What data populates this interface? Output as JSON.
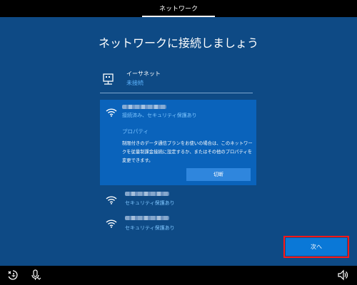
{
  "header": {
    "tab_label": "ネットワーク"
  },
  "main": {
    "title": "ネットワークに接続しましょう"
  },
  "ethernet": {
    "name": "イーサネット",
    "status": "未接続",
    "icon": "ethernet-icon"
  },
  "networks": [
    {
      "status": "接続済み、セキュリティ保護あり",
      "expanded": true,
      "properties_label": "プロパティ",
      "description": "制限付きのデータ通信プランをお使いの場合は、このネットワークを従量制課金接続に設定するか、またはその他のプロパティを変更できます。",
      "disconnect_label": "切断"
    },
    {
      "status": "セキュリティ保護あり"
    },
    {
      "status": "セキュリティ保護あり"
    }
  ],
  "buttons": {
    "next_label": "次へ"
  },
  "colors": {
    "background": "#0e4a85",
    "selected_card": "#0a63bb",
    "accent_text": "#5eb5ff",
    "button": "#0a78d7",
    "highlight_outline": "#ff1818"
  },
  "icons": {
    "bottom_left": [
      "ease-of-access-icon",
      "microphone-icon"
    ],
    "bottom_right": [
      "volume-icon"
    ]
  }
}
